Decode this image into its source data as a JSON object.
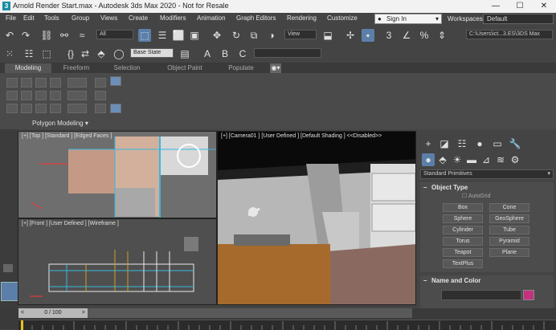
{
  "window": {
    "title": "Arnold Render Start.max - Autodesk 3ds Max 2020 - Not for Resale",
    "app_icon_letter": "3",
    "minimize_glyph": "—",
    "maximize_glyph": "☐",
    "close_glyph": "✕"
  },
  "menubar": {
    "items": [
      "File",
      "Edit",
      "Tools",
      "Group",
      "Views",
      "Create",
      "Modifiers",
      "Animation",
      "Graph Editors",
      "Rendering",
      "Customize"
    ],
    "sign_in": "Sign In",
    "workspaces_label": "Workspaces:",
    "workspace_value": "Default"
  },
  "toolbar": {
    "selection_filter": "All",
    "reference_coord": "View",
    "path_field": "C:\\Users\\ict...3.ES\\3DS Max",
    "base_state": "Base State",
    "create_selection_set": ""
  },
  "ribbon": {
    "tabs": [
      "Modeling",
      "Freeform",
      "Selection",
      "Object Paint",
      "Populate"
    ],
    "panel_label": "Polygon Modeling ▾"
  },
  "viewports": {
    "top": "[+] [Top ] [Standard ] [Edged Faces ]",
    "front": "[+] [Front ] [User Defined ] [Wireframe ]",
    "camera": "[+] [Camera01 ] [User Defined ] [Default Shading ] <<Disabled>>"
  },
  "command_panel": {
    "dropdown": "Standard Primitives",
    "object_type_title": "Object Type",
    "autogrid_label": "AutoGrid",
    "buttons": [
      "Box",
      "Cone",
      "Sphere",
      "GeoSphere",
      "Cylinder",
      "Tube",
      "Torus",
      "Pyramid",
      "Teapot",
      "Plane",
      "TextPlus"
    ],
    "name_color_title": "Name and Color",
    "swatch_color": "#c4317f",
    "rollout_sign": "–"
  },
  "timeline": {
    "frame_counter": "0 / 100",
    "slider_position": 0,
    "frame_total": 100,
    "play_icon": "play-icon",
    "arrow_left": "<",
    "arrow_right": ">"
  }
}
